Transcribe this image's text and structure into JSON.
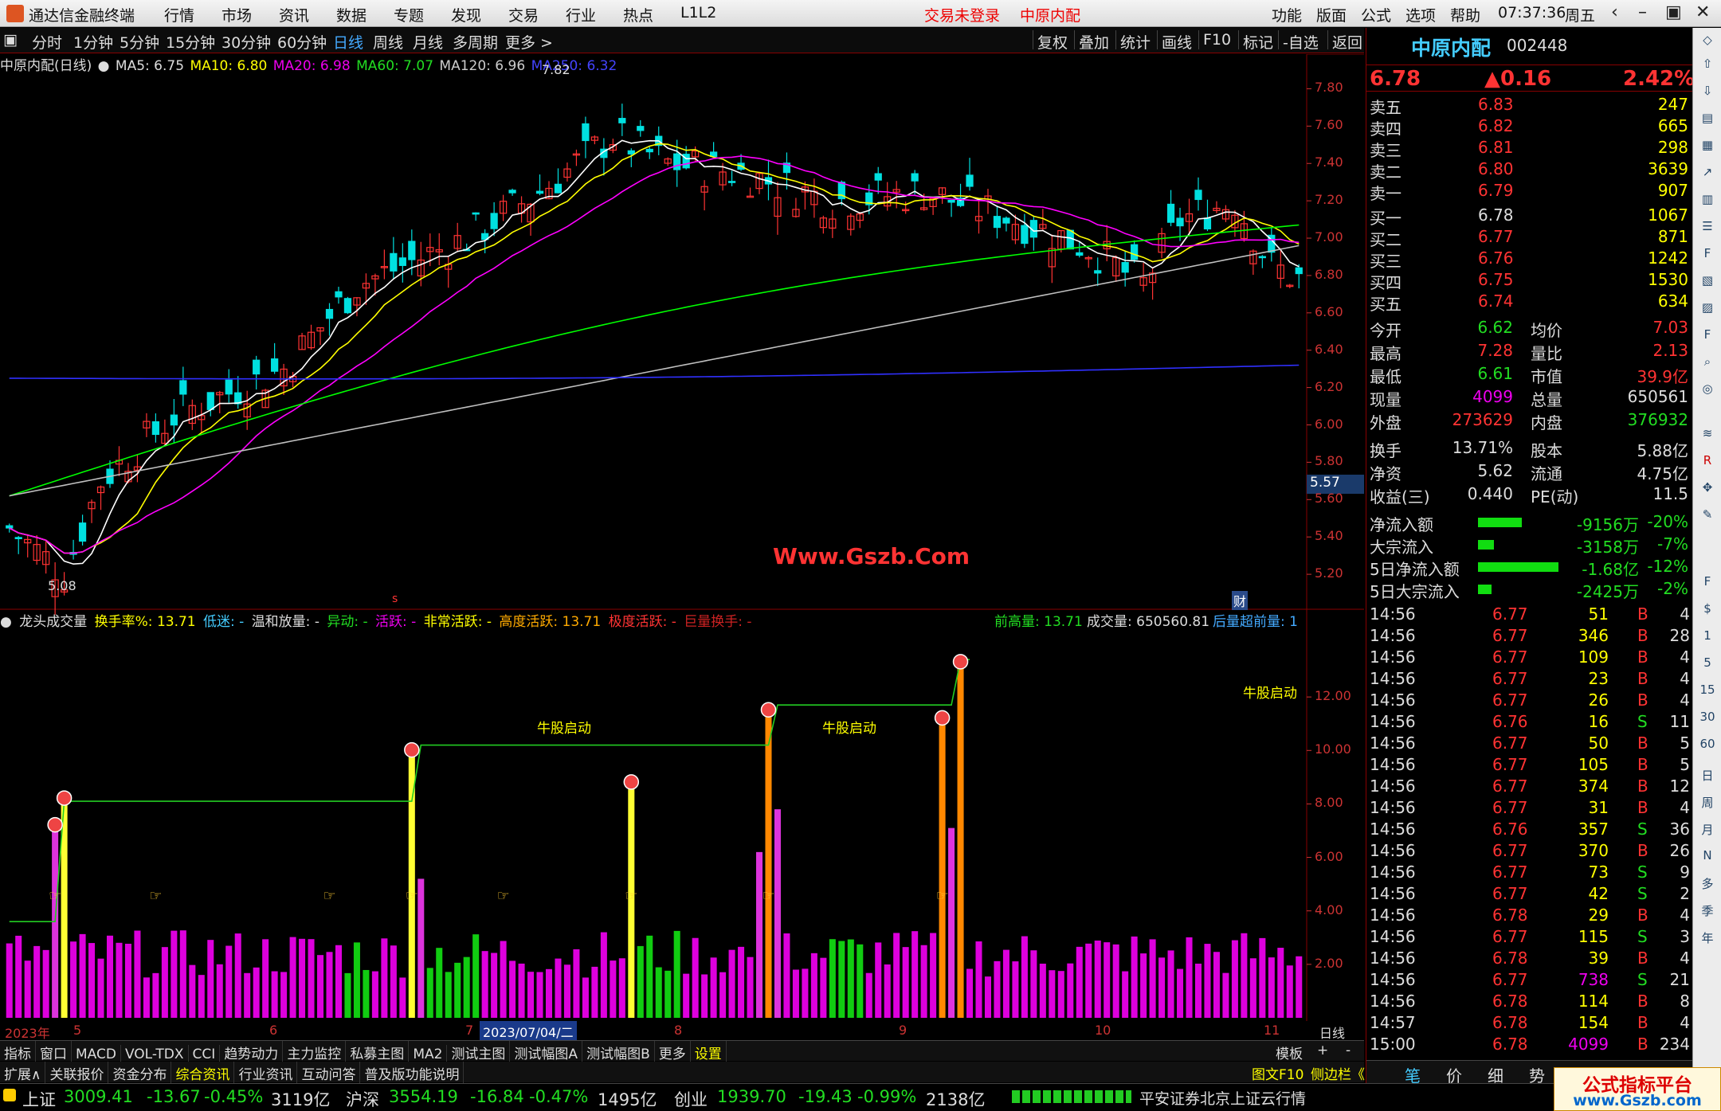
{
  "window": {
    "app_title": "通达信金融终端",
    "menu": [
      "行情",
      "市场",
      "资讯",
      "数据",
      "专题",
      "发现",
      "交易",
      "行业",
      "热点",
      "L1L2"
    ],
    "status_red": [
      "交易未登录",
      "中原内配"
    ],
    "right_menu": [
      "功能",
      "版面",
      "公式",
      "选项",
      "帮助"
    ],
    "clock": "07:37:36",
    "weekday": "周五"
  },
  "timeframe_tabs": [
    "分时",
    "1分钟",
    "5分钟",
    "15分钟",
    "30分钟",
    "60分钟",
    "日线",
    "周线",
    "月线",
    "多周期",
    "更多 >"
  ],
  "selected_timeframe": "日线",
  "chart_tools": [
    "复权",
    "叠加",
    "统计",
    "画线",
    "F10",
    "标记",
    "-自选",
    "返回"
  ],
  "main_legend": {
    "name": "中原内配(日线)",
    "ma5": "MA5: 6.75",
    "ma10": "MA10: 6.80",
    "ma20": "MA20: 6.98",
    "ma60": "MA60: 7.07",
    "ma120": "MA120: 6.96",
    "ma250": "MA250: 6.32"
  },
  "main_chart": {
    "high_label": "7.82",
    "low_label": "5.08",
    "current_price_tag": "5.57",
    "watermark": "Www.Gszb.Com",
    "marker_s": "s",
    "marker_cai": "财",
    "y_ticks": [
      "7.80",
      "7.60",
      "7.40",
      "7.20",
      "7.00",
      "6.80",
      "6.60",
      "6.40",
      "6.20",
      "6.00",
      "5.80",
      "5.60",
      "5.40",
      "5.20"
    ]
  },
  "indicator_legend": {
    "name": "龙头成交量",
    "turnover": "换手率%: 13.71",
    "low": "低迷: -",
    "mild": "温和放量: -",
    "abnormal": "异动: -",
    "active": "活跃: -",
    "very_active": "非常活跃: -",
    "high_active": "高度活跃: 13.71",
    "extreme": "极度活跃: -",
    "huge": "巨量换手: -",
    "prev_high": "前高量: 13.71",
    "volume": "成交量: 650560.81",
    "rising": "后量超前量: 1"
  },
  "indicator_chart": {
    "labels": [
      "牛股启动",
      "牛股启动",
      "牛股启动"
    ],
    "y_ticks": [
      "12.00",
      "10.00",
      "8.00",
      "6.00",
      "4.00",
      "2.00"
    ]
  },
  "date_bar": {
    "items": [
      "2023年",
      "5",
      "6",
      "7",
      "2023/07/04/二",
      "8",
      "9",
      "10",
      "11"
    ],
    "period": "日线"
  },
  "tabs_row1": [
    "指标",
    "窗口",
    "MACD",
    "VOL-TDX",
    "CCI",
    "趋势动力",
    "主力监控",
    "私募主图",
    "MA2",
    "测试主图",
    "测试幅图A",
    "测试幅图B",
    "更多",
    "设置"
  ],
  "tabs_row1_right": [
    "模板",
    "+",
    "-"
  ],
  "tabs_row2": [
    "扩展∧",
    "关联报价",
    "资金分布",
    "综合资讯",
    "行业资讯",
    "互动问答",
    "普及版功能说明"
  ],
  "tabs_row2_right": [
    "图文F10",
    "侧边栏《"
  ],
  "quote": {
    "name": "中原内配",
    "code": "002448",
    "price": "6.78",
    "change": "▲0.16",
    "pct": "2.42%",
    "asks": [
      {
        "label": "卖五",
        "price": "6.83",
        "vol": "247"
      },
      {
        "label": "卖四",
        "price": "6.82",
        "vol": "665"
      },
      {
        "label": "卖三",
        "price": "6.81",
        "vol": "298"
      },
      {
        "label": "卖二",
        "price": "6.80",
        "vol": "3639"
      },
      {
        "label": "卖一",
        "price": "6.79",
        "vol": "907"
      }
    ],
    "bids": [
      {
        "label": "买一",
        "price": "6.78",
        "vol": "1067"
      },
      {
        "label": "买二",
        "price": "6.77",
        "vol": "871"
      },
      {
        "label": "买三",
        "price": "6.76",
        "vol": "1242"
      },
      {
        "label": "买四",
        "price": "6.75",
        "vol": "1530"
      },
      {
        "label": "买五",
        "price": "6.74",
        "vol": "634"
      }
    ],
    "stats": [
      {
        "l1": "今开",
        "v1": "6.62",
        "l2": "均价",
        "v2": "7.03"
      },
      {
        "l1": "最高",
        "v1": "7.28",
        "l2": "量比",
        "v2": "2.13"
      },
      {
        "l1": "最低",
        "v1": "6.61",
        "l2": "市值",
        "v2": "39.9亿"
      },
      {
        "l1": "现量",
        "v1": "4099",
        "l2": "总量",
        "v2": "650561"
      },
      {
        "l1": "外盘",
        "v1": "273629",
        "l2": "内盘",
        "v2": "376932"
      }
    ],
    "stats2": [
      {
        "l1": "换手",
        "v1": "13.71%",
        "l2": "股本",
        "v2": "5.88亿"
      },
      {
        "l1": "净资",
        "v1": "5.62",
        "l2": "流通",
        "v2": "4.75亿"
      },
      {
        "l1": "收益(三)",
        "v1": "0.440",
        "l2": "PE(动)",
        "v2": "11.5"
      }
    ],
    "flows": [
      {
        "label": "净流入额",
        "value": "-9156万",
        "pct": "-20%",
        "bar": 0.5
      },
      {
        "label": "大宗流入",
        "value": "-3158万",
        "pct": "-7%",
        "bar": 0.18
      },
      {
        "label": "5日净流入额",
        "value": "-1.68亿",
        "pct": "-12%",
        "bar": 0.92
      },
      {
        "label": "5日大宗流入",
        "value": "-2425万",
        "pct": "-2%",
        "bar": 0.15
      }
    ],
    "ticks": [
      {
        "t": "14:56",
        "p": "6.77",
        "v": "51",
        "d": "B",
        "n": "4"
      },
      {
        "t": "14:56",
        "p": "6.77",
        "v": "346",
        "d": "B",
        "n": "28"
      },
      {
        "t": "14:56",
        "p": "6.77",
        "v": "109",
        "d": "B",
        "n": "4"
      },
      {
        "t": "14:56",
        "p": "6.77",
        "v": "23",
        "d": "B",
        "n": "4"
      },
      {
        "t": "14:56",
        "p": "6.77",
        "v": "26",
        "d": "B",
        "n": "4"
      },
      {
        "t": "14:56",
        "p": "6.76",
        "v": "16",
        "d": "S",
        "n": "11"
      },
      {
        "t": "14:56",
        "p": "6.77",
        "v": "50",
        "d": "B",
        "n": "5"
      },
      {
        "t": "14:56",
        "p": "6.77",
        "v": "105",
        "d": "B",
        "n": "5"
      },
      {
        "t": "14:56",
        "p": "6.77",
        "v": "374",
        "d": "B",
        "n": "12"
      },
      {
        "t": "14:56",
        "p": "6.77",
        "v": "31",
        "d": "B",
        "n": "4"
      },
      {
        "t": "14:56",
        "p": "6.76",
        "v": "357",
        "d": "S",
        "n": "36"
      },
      {
        "t": "14:56",
        "p": "6.77",
        "v": "370",
        "d": "B",
        "n": "26"
      },
      {
        "t": "14:56",
        "p": "6.77",
        "v": "73",
        "d": "S",
        "n": "9"
      },
      {
        "t": "14:56",
        "p": "6.77",
        "v": "42",
        "d": "S",
        "n": "2"
      },
      {
        "t": "14:56",
        "p": "6.78",
        "v": "29",
        "d": "B",
        "n": "4"
      },
      {
        "t": "14:56",
        "p": "6.77",
        "v": "115",
        "d": "S",
        "n": "3"
      },
      {
        "t": "14:56",
        "p": "6.78",
        "v": "39",
        "d": "B",
        "n": "4"
      },
      {
        "t": "14:56",
        "p": "6.77",
        "v": "738",
        "d": "S",
        "n": "21"
      },
      {
        "t": "14:56",
        "p": "6.78",
        "v": "114",
        "d": "B",
        "n": "8"
      },
      {
        "t": "14:57",
        "p": "6.78",
        "v": "154",
        "d": "B",
        "n": "4"
      },
      {
        "t": "15:00",
        "p": "6.78",
        "v": "4099",
        "d": "B",
        "n": "234"
      }
    ],
    "bottom_tabs": [
      "笔",
      "价",
      "细",
      "势"
    ]
  },
  "statusbar": {
    "indices": [
      {
        "name": "上证",
        "val": "3009.41",
        "chg": "-13.67",
        "pct": "-0.45%",
        "amt": "3119亿"
      },
      {
        "name": "沪深",
        "val": "3554.19",
        "chg": "-16.84",
        "pct": "-0.47%",
        "amt": "1495亿"
      },
      {
        "name": "创业",
        "val": "1939.70",
        "chg": "-19.43",
        "pct": "-0.99%",
        "amt": "2138亿"
      }
    ],
    "broker": "平安证券北京上证云行情"
  },
  "side_icons": [
    "1",
    "5",
    "15",
    "30",
    "60",
    "日",
    "周",
    "月",
    "N",
    "多",
    "季",
    "年"
  ],
  "bottom_logo": {
    "line1": "公式指标平台",
    "line2": "www.Gszb.com"
  },
  "colors": {
    "up": "#ff3333",
    "down": "#00e0e0",
    "ma5": "#ffffff",
    "ma10": "#ffff00",
    "ma20": "#ff00ff",
    "ma60": "#00ff00",
    "ma120": "#c0c0c0",
    "ma250": "#3030ff"
  }
}
